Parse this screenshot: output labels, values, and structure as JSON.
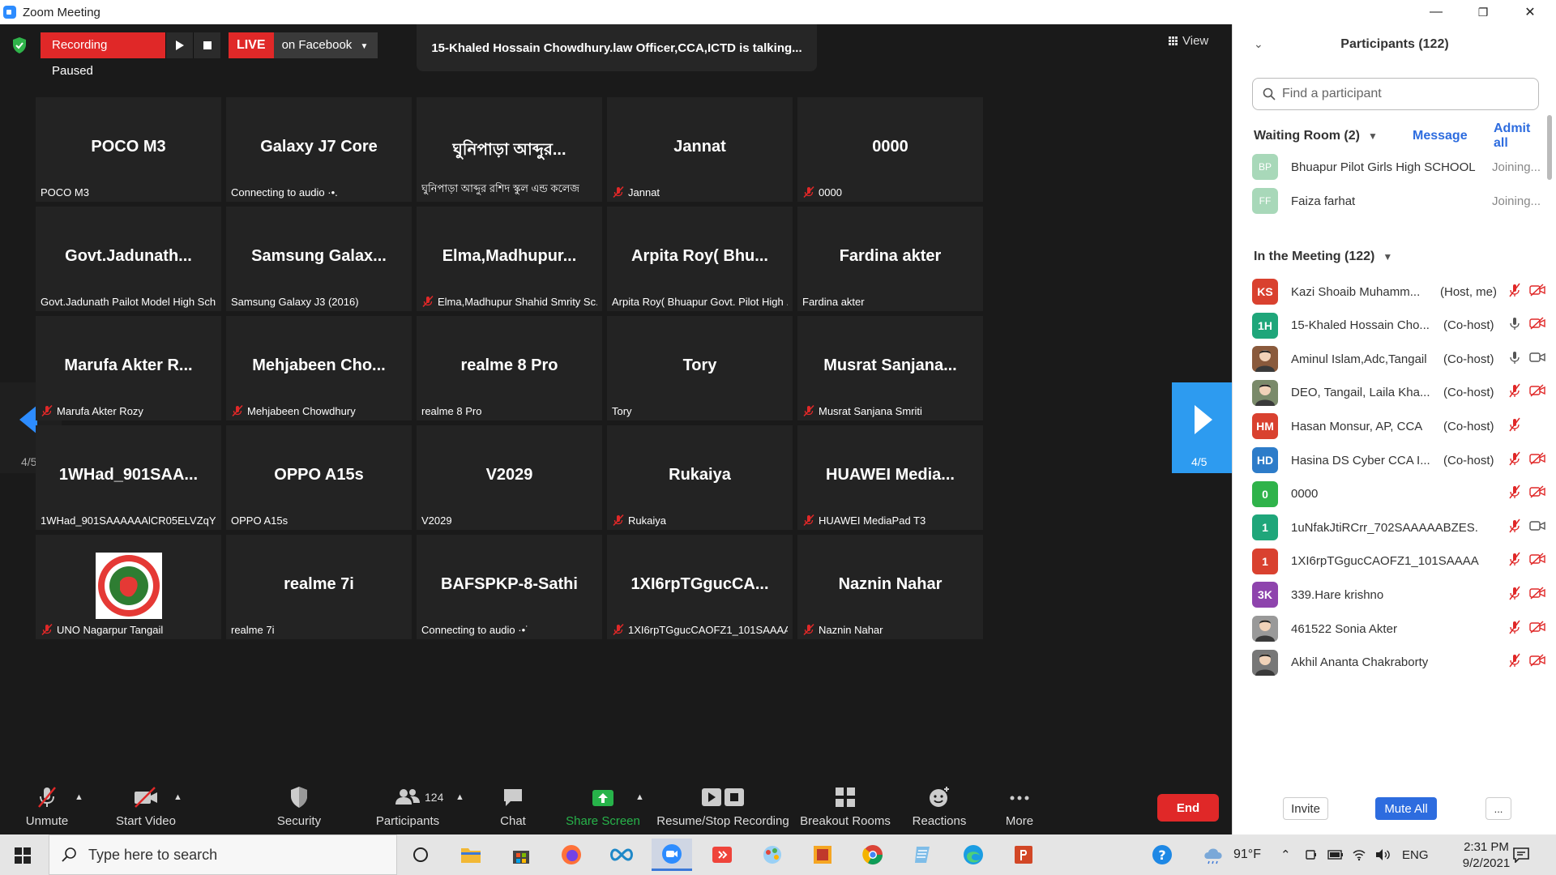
{
  "window": {
    "title": "Zoom Meeting",
    "minimize": "—",
    "maximize": "❐",
    "close": "✕"
  },
  "meeting": {
    "recording_status": "Recording Paused",
    "live_label": "LIVE",
    "live_destination": "on Facebook",
    "talking": "15-Khaled Hossain Chowdhury.law Officer,CCA,ICTD is talking...",
    "view_label": "View",
    "page_indicator_left": "4/5",
    "page_indicator_right": "4/5",
    "tiles": [
      {
        "big": "POCO M3",
        "label": "POCO M3",
        "muted": false
      },
      {
        "big": "Galaxy J7 Core",
        "label": "Connecting to audio ·•.",
        "muted": false
      },
      {
        "big": "ঘুনিপাড়া আব্দুর...",
        "label": "ঘুনিপাড়া আব্দুর রশিদ স্কুল এন্ড কলেজ",
        "muted": false
      },
      {
        "big": "Jannat",
        "label": "Jannat",
        "muted": true
      },
      {
        "big": "0000",
        "label": "0000",
        "muted": true
      },
      {
        "big": "Govt.Jadunath...",
        "label": "Govt.Jadunath Pailot Model High Sch...",
        "muted": false
      },
      {
        "big": "Samsung  Galax...",
        "label": "Samsung Galaxy J3 (2016)",
        "muted": false
      },
      {
        "big": "Elma,Madhupur...",
        "label": "Elma,Madhupur Shahid Smrity Sc...",
        "muted": true
      },
      {
        "big": "Arpita  Roy( Bhu...",
        "label": "Arpita Roy( Bhuapur Govt. Pilot High ...",
        "muted": false
      },
      {
        "big": "Fardina akter",
        "label": "Fardina akter",
        "muted": false
      },
      {
        "big": "Marufa  Akter  R...",
        "label": "Marufa Akter Rozy",
        "muted": true
      },
      {
        "big": "Mehjabeen  Cho...",
        "label": "Mehjabeen Chowdhury",
        "muted": true
      },
      {
        "big": "realme 8 Pro",
        "label": "realme 8 Pro",
        "muted": false
      },
      {
        "big": "Tory",
        "label": "Tory",
        "muted": false
      },
      {
        "big": "Musrat  Sanjana...",
        "label": "Musrat Sanjana Smriti",
        "muted": true
      },
      {
        "big": "1WHad_901SAA...",
        "label": "1WHad_901SAAAAAAlCR05ELVZqYz...",
        "muted": false
      },
      {
        "big": "OPPO A15s",
        "label": "OPPO A15s",
        "muted": false
      },
      {
        "big": "V2029",
        "label": "V2029",
        "muted": false
      },
      {
        "big": "Rukaiya",
        "label": "Rukaiya",
        "muted": true
      },
      {
        "big": "HUAWEI  Media...",
        "label": "HUAWEI MediaPad T3",
        "muted": true
      },
      {
        "big": "",
        "label": "UNO Nagarpur Tangail",
        "muted": true,
        "logo": true
      },
      {
        "big": "realme 7i",
        "label": "realme 7i",
        "muted": false
      },
      {
        "big": "BAFSPKP-8-Sathi",
        "label": "Connecting to audio ·•˙",
        "muted": false
      },
      {
        "big": "1XI6rpTGgucCA...",
        "label": "1XI6rpTGgucCAOFZ1_101SAAAA...",
        "muted": true
      },
      {
        "big": "Naznin Nahar",
        "label": "Naznin Nahar",
        "muted": true
      }
    ]
  },
  "toolbar": {
    "unmute": "Unmute",
    "start_video": "Start Video",
    "security": "Security",
    "participants": "Participants",
    "participants_count": "124",
    "chat": "Chat",
    "share_screen": "Share Screen",
    "recording": "Resume/Stop Recording",
    "breakout": "Breakout Rooms",
    "reactions": "Reactions",
    "more": "More",
    "end": "End"
  },
  "panel": {
    "title": "Participants (122)",
    "search_placeholder": "Find a participant",
    "waiting_room": "Waiting Room (2)",
    "message": "Message",
    "admit_all": "Admit all",
    "in_meeting": "In the Meeting (122)",
    "waiting": [
      {
        "initials": "BP",
        "name": "Bhuapur Pilot Girls High SCHOOL",
        "status": "Joining...",
        "color": "#a8d8b9"
      },
      {
        "initials": "FF",
        "name": "Faiza farhat",
        "status": "Joining...",
        "color": "#a8d8b9"
      }
    ],
    "participants": [
      {
        "initials": "KS",
        "name": "Kazi Shoaib Muhamm...",
        "role": "(Host, me)",
        "color": "#d9412f",
        "mic": "muted",
        "cam": "off"
      },
      {
        "initials": "1H",
        "name": "15-Khaled Hossain Cho...",
        "role": "(Co-host)",
        "color": "#1fa67a",
        "mic": "on",
        "cam": "off"
      },
      {
        "initials": "",
        "name": "Aminul Islam,Adc,Tangail",
        "role": "(Co-host)",
        "color": "#8a5a3c",
        "mic": "on",
        "cam": "on",
        "photo": true
      },
      {
        "initials": "",
        "name": "DEO, Tangail, Laila Kha...",
        "role": "(Co-host)",
        "color": "#7a8a6a",
        "mic": "muted",
        "cam": "off",
        "photo": true
      },
      {
        "initials": "HM",
        "name": "Hasan Monsur, AP, CCA",
        "role": "(Co-host)",
        "color": "#d9412f",
        "mic": "muted",
        "cam": "none"
      },
      {
        "initials": "HD",
        "name": "Hasina DS Cyber CCA I...",
        "role": "(Co-host)",
        "color": "#2d7cc9",
        "mic": "muted",
        "cam": "off"
      },
      {
        "initials": "0",
        "name": "0000",
        "role": "",
        "color": "#2fb34a",
        "mic": "muted",
        "cam": "off"
      },
      {
        "initials": "1",
        "name": "1uNfakJtiRCrr_702SAAAAABZES...",
        "role": "",
        "color": "#1fa67a",
        "mic": "muted",
        "cam": "on"
      },
      {
        "initials": "1",
        "name": "1XI6rpTGgucCAOFZ1_101SAAAA...",
        "role": "",
        "color": "#d9412f",
        "mic": "muted",
        "cam": "off"
      },
      {
        "initials": "3K",
        "name": "339.Hare krishno",
        "role": "",
        "color": "#8e44ad",
        "mic": "muted",
        "cam": "off"
      },
      {
        "initials": "",
        "name": "461522 Sonia Akter",
        "role": "",
        "color": "#999999",
        "mic": "muted",
        "cam": "off",
        "photo": true
      },
      {
        "initials": "",
        "name": "Akhil Ananta Chakraborty",
        "role": "",
        "color": "#777777",
        "mic": "muted",
        "cam": "off",
        "photo": true
      }
    ],
    "invite": "Invite",
    "mute_all": "Mute All",
    "more": "..."
  },
  "taskbar": {
    "search_placeholder": "Type here to search",
    "weather": "91°F",
    "language": "ENG",
    "time": "2:31 PM",
    "date": "9/2/2021"
  },
  "colors": {
    "accent": "#2d8cff",
    "danger": "#e02828",
    "share_green": "#27b34a",
    "link_blue": "#2d6cdf"
  }
}
